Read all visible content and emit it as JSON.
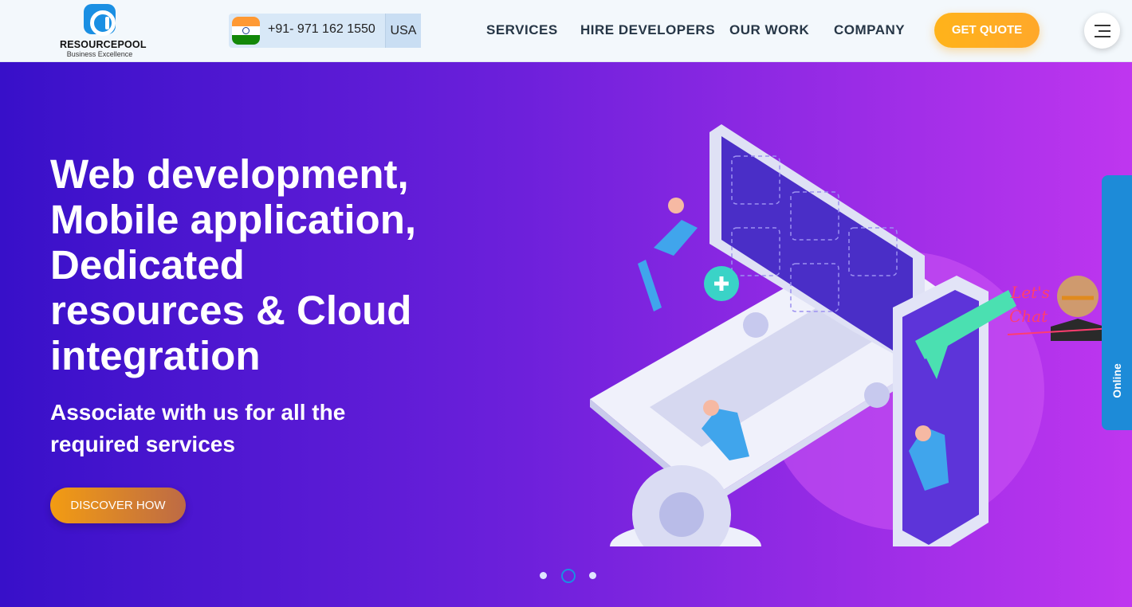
{
  "header": {
    "logo_name": "RESOURCEPOOL",
    "logo_tagline": "Business Excellence",
    "phone": "+91- 971 162 1550",
    "country": "USA",
    "nav": [
      "SERVICES",
      "HIRE DEVELOPERS",
      "OUR WORK",
      "COMPANY"
    ],
    "quote_label": "GET QUOTE",
    "icons": {
      "flag": "india-flag-icon",
      "menu": "hamburger-menu-icon"
    }
  },
  "hero": {
    "title_lines": [
      "Web development,",
      "Mobile application,",
      "Dedicated",
      "resources & Cloud",
      "integration"
    ],
    "subtitle_lines": [
      "Associate with us for all the",
      "required services"
    ],
    "cta_label": "DISCOVER HOW",
    "slider": {
      "slides": 3,
      "active": 2
    },
    "illustration": "laptop-and-phone-developer-illustration"
  },
  "chat": {
    "label": "Online",
    "widget_text": "Let's Chat"
  },
  "colors": {
    "accent": "#ffa82a",
    "brand": "#1a8fe3",
    "hero_start": "#3810c9",
    "hero_end": "#bf36ef"
  }
}
